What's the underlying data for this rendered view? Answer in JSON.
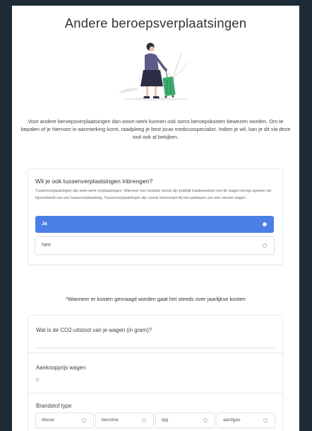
{
  "page": {
    "title": "Andere beroepsverplaatsingen",
    "intro": "Voor andere beroepsverplaatsingen dan woon-werk kunnen ook soms beroepskosten bewezen worden. Om te bepalen of je hiervoor in aanmerking komt, raadpleeg je best jouw medicusspecialist. Indien je wil, kan je dit via deze tool ook al bekijken."
  },
  "question1": {
    "title": "Wil je ook tussenverplaatsingen inbrengen?",
    "help": "Tussenverplaatsingen zijn werk-werk verplaatsingen. Wanneer een huisarts vanuit zijn praktijk huisbezoeken met de wagen brengt spreken we bijvoorbeeld van een tussenverplaatsing. Tussenverplaatsingen zijn vooral interessant bij het aankopen van een nieuwe wagen.",
    "options": [
      {
        "label": "Ja",
        "selected": true
      },
      {
        "label": "Nee",
        "selected": false
      }
    ]
  },
  "note": "*Wanneer er kosten gevraagd worden gaat het steeds over jaarlijkse kosten",
  "form": {
    "co2_label": "Wat is de CO2-uitstoot van je wagen (in gram)?",
    "co2_value": "",
    "price_label": "Aankoopprijs wagen",
    "price_value": "0",
    "fuel_label": "Brandstof type",
    "fuel_options": [
      "diesel",
      "benzine",
      "lpg",
      "aardgas"
    ]
  },
  "colors": {
    "background": "#1c2b36",
    "accent": "#4b7fe6",
    "suitcase": "#3daa6e"
  },
  "icons": {
    "illustration": "woman-with-suitcase-illustration",
    "radio": "radio-circle-icon"
  }
}
